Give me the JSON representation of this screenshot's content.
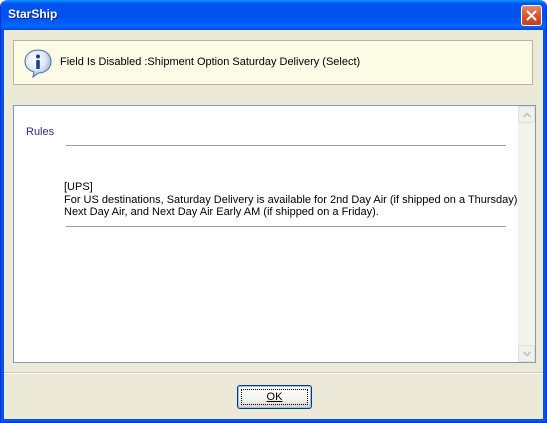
{
  "window": {
    "title": "StarShip"
  },
  "message": {
    "icon": "info-icon",
    "text": "Field Is Disabled :Shipment Option Saturday Delivery (Select)"
  },
  "rules": {
    "label": "Rules",
    "lines": [
      "[UPS]",
      "For US destinations, Saturday Delivery is available for 2nd Day Air (if shipped on a Thursday),",
      "Next Day Air, and Next Day Air Early AM (if shipped on a Friday)."
    ]
  },
  "buttons": {
    "ok_label": "OK"
  }
}
